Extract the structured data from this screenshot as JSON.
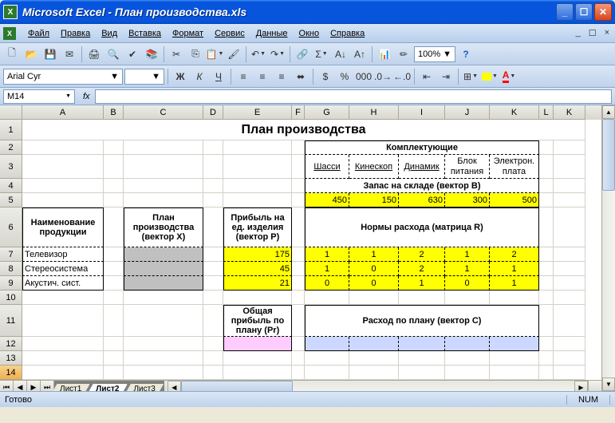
{
  "window": {
    "title": "Microsoft Excel - План производства.xls"
  },
  "menu": {
    "items": [
      "Файл",
      "Правка",
      "Вид",
      "Вставка",
      "Формат",
      "Сервис",
      "Данные",
      "Окно",
      "Справка"
    ]
  },
  "toolbar": {
    "zoom": "100%"
  },
  "formatbar": {
    "font": "Arial Cyr",
    "size": ""
  },
  "namebox": "M14",
  "formula": "",
  "columns": [
    "A",
    "B",
    "C",
    "D",
    "E",
    "F",
    "G",
    "H",
    "I",
    "J",
    "K"
  ],
  "sheet_title": "План производства",
  "headers": {
    "komplekt": "Комплектующие",
    "komp_cols": [
      "Шасси",
      "Кинескоп",
      "Динамик",
      "Блок питания",
      "Электрон. плата"
    ],
    "zapas": "Запас на складе (вектор B)",
    "zapas_vals": [
      450,
      150,
      630,
      300,
      500
    ],
    "naim": "Наименование продукции",
    "plan": "План производства (вектор X)",
    "pribyl": "Прибыль на ед. изделия (вектор P)",
    "normy": "Нормы расхода (матрица R)",
    "products": [
      "Телевизор",
      "Стереосистема",
      "Акустич. сист."
    ],
    "profit": [
      175,
      45,
      21
    ],
    "matrix": [
      [
        1,
        1,
        2,
        1,
        2
      ],
      [
        1,
        0,
        2,
        1,
        1
      ],
      [
        0,
        0,
        1,
        0,
        1
      ]
    ],
    "total_profit": "Общая прибыль по плану (Pr)",
    "rashod": "Расход по плану (вектор C)"
  },
  "sheettabs": [
    "Лист1",
    "Лист2",
    "Лист3"
  ],
  "active_sheet": 1,
  "status": "Готово",
  "numlock": "NUM"
}
